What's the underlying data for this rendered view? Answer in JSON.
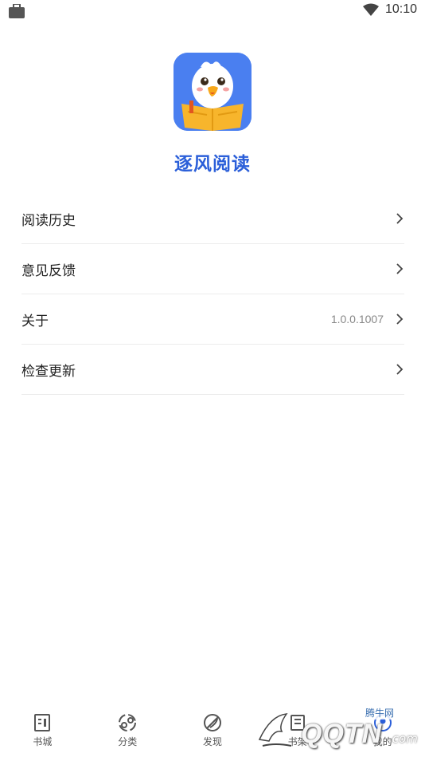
{
  "status_bar": {
    "time": "10:10",
    "left_icon": "briefcase-icon",
    "right_icon": "wifi-icon"
  },
  "app": {
    "name": "逐风阅读",
    "logo_icon": "eagle-reading-book-logo",
    "accent": "#2b5fd9",
    "logo_bg": "#4a7ff0"
  },
  "menu": {
    "items": [
      {
        "label": "阅读历史",
        "value": ""
      },
      {
        "label": "意见反馈",
        "value": ""
      },
      {
        "label": "关于",
        "value": "1.0.0.1007"
      },
      {
        "label": "检查更新",
        "value": ""
      }
    ]
  },
  "tabs": [
    {
      "label": "书城",
      "icon": "bookstore-icon"
    },
    {
      "label": "分类",
      "icon": "category-icon"
    },
    {
      "label": "发现",
      "icon": "discover-icon"
    },
    {
      "label": "书架",
      "icon": "bookshelf-icon"
    },
    {
      "label": "我的",
      "icon": "profile-icon"
    }
  ],
  "watermark": {
    "text": "QQTN",
    "small": "腾牛网",
    "suffix": ".com"
  }
}
